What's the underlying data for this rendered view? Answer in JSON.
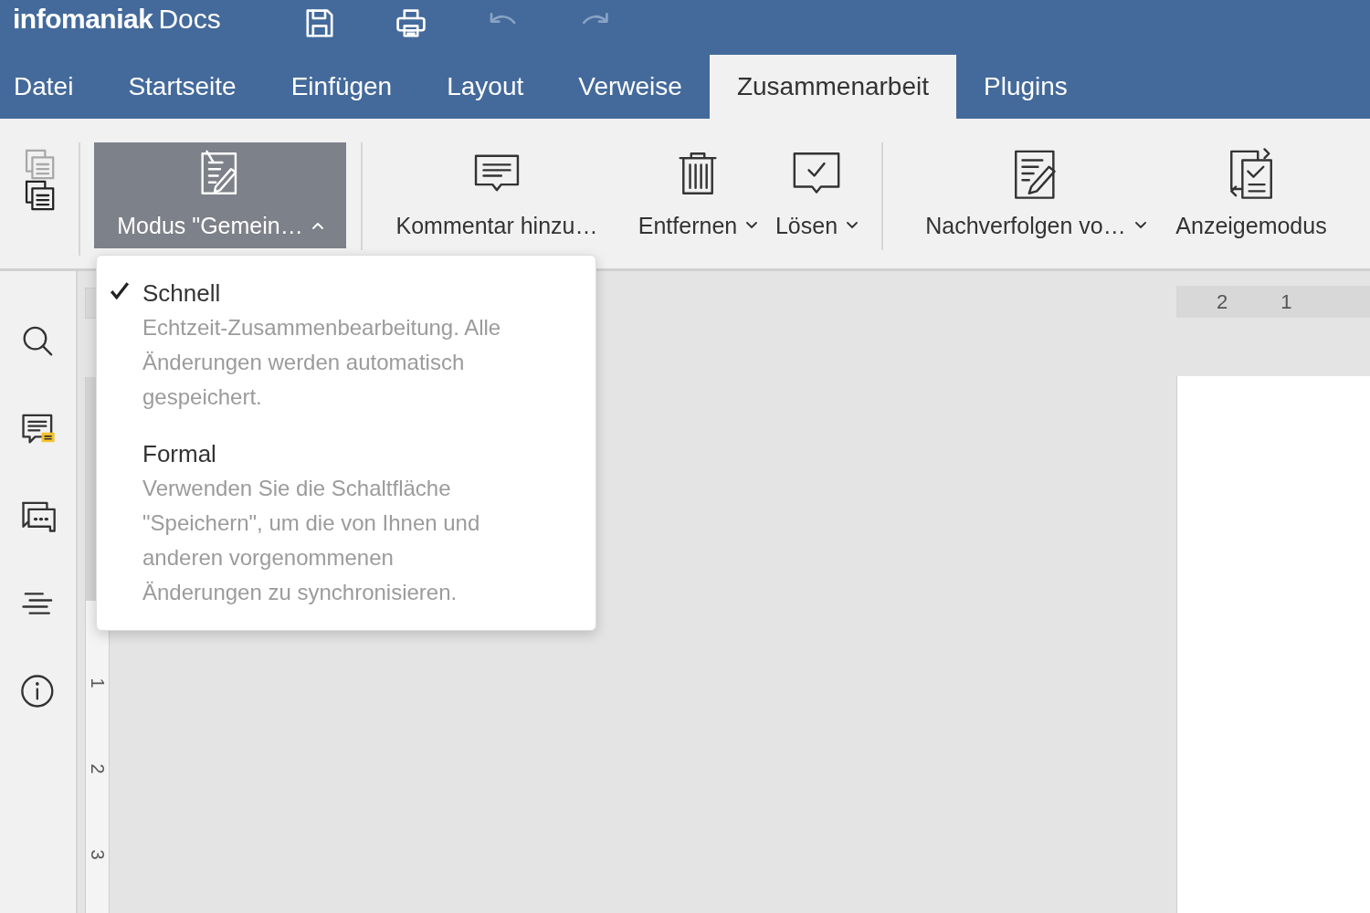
{
  "header": {
    "brand": "infomaniak",
    "product": "Docs",
    "quick_actions": [
      {
        "disabled": false
      },
      {
        "disabled": false
      },
      {
        "disabled": true
      },
      {
        "disabled": true
      }
    ]
  },
  "tabs": [
    {
      "label": "Datei",
      "selected": false
    },
    {
      "label": "Startseite",
      "selected": false
    },
    {
      "label": "Einfügen",
      "selected": false
    },
    {
      "label": "Layout",
      "selected": false
    },
    {
      "label": "Verweise",
      "selected": false
    },
    {
      "label": "Zusammenarbeit",
      "selected": true
    },
    {
      "label": "Plugins",
      "selected": false
    }
  ],
  "toolbar": {
    "clipboard": [
      {
        "disabled": true
      },
      {
        "disabled": false
      }
    ],
    "buttons": [
      {
        "label": "Modus \"Gemein…",
        "dropdown": true,
        "expanded": true
      },
      {
        "label": "Kommentar hinzu…",
        "dropdown": false,
        "expanded": false
      },
      {
        "label": "Entfernen",
        "dropdown": true,
        "expanded": false
      },
      {
        "label": "Lösen",
        "dropdown": true,
        "expanded": false
      },
      {
        "label": "Nachverfolgen vo…",
        "dropdown": true,
        "expanded": false
      },
      {
        "label": "Anzeigemodus",
        "dropdown": false,
        "expanded": false
      }
    ]
  },
  "mode_menu": {
    "items": [
      {
        "title": "Schnell",
        "description": "Echtzeit-Zusammenbearbeitung. Alle Änderungen werden automatisch gespeichert.",
        "selected": true
      },
      {
        "title": "Formal",
        "description": "Verwenden Sie die Schaltfläche \"Speichern\", um die von Ihnen und anderen vorgenommenen Änderungen zu synchronisieren.",
        "selected": false
      }
    ]
  },
  "rulers": {
    "horizontal_labels": [
      "2",
      "1"
    ],
    "vertical_labels": [
      "1",
      "2",
      "3"
    ]
  }
}
